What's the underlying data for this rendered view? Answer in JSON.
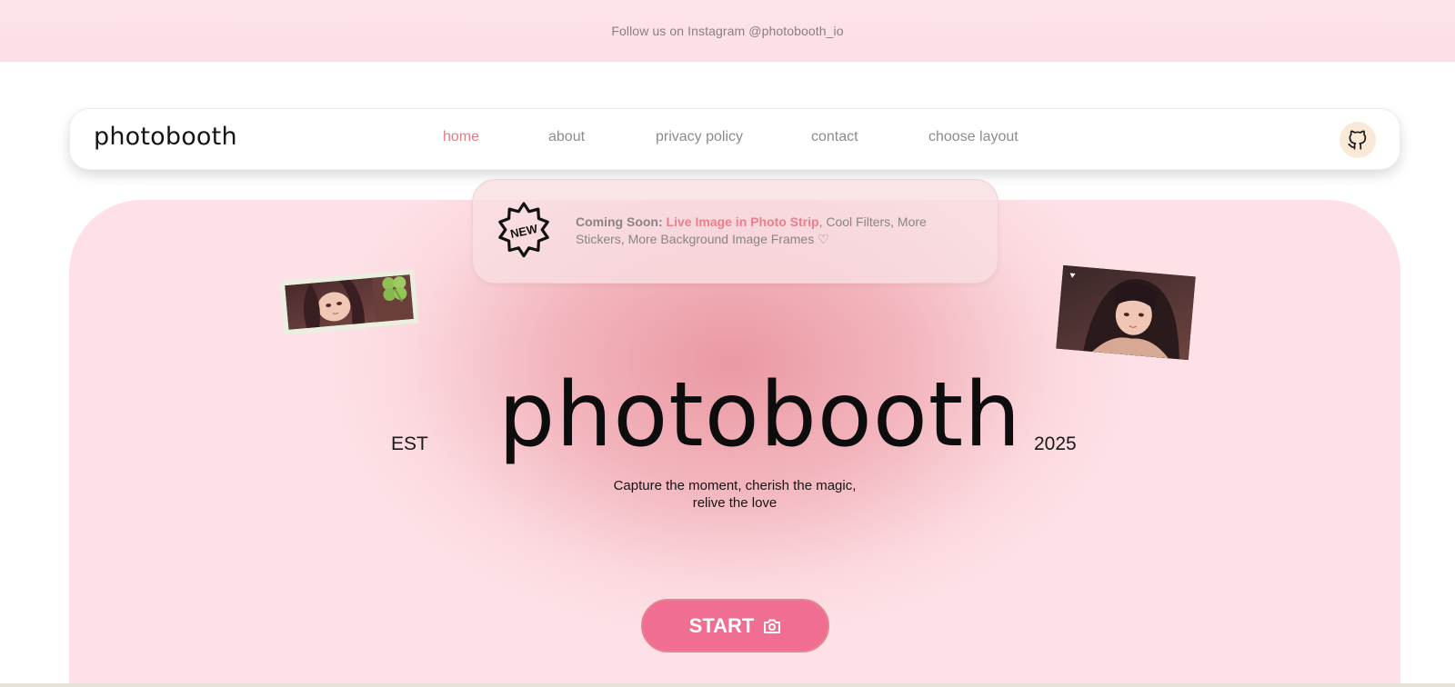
{
  "topbar": {
    "text": "Follow us on Instagram @photobooth_io"
  },
  "navbar": {
    "brand": "photobooth",
    "links": [
      {
        "label": "home",
        "active": true
      },
      {
        "label": "about",
        "active": false
      },
      {
        "label": "privacy policy",
        "active": false
      },
      {
        "label": "contact",
        "active": false
      },
      {
        "label": "choose layout",
        "active": false
      }
    ],
    "github_icon": "github-icon"
  },
  "announcement": {
    "badge": "NEW",
    "lead": "Coming Soon:",
    "highlight": "Live Image in Photo Strip",
    "rest": ", Cool Filters, More Stickers, More Background Image Frames ♡"
  },
  "hero": {
    "est": "EST",
    "title": "photobooth",
    "year": "2025",
    "tagline_line1": "Capture the moment, cherish the magic,",
    "tagline_line2": "relive the love",
    "start_label": "START",
    "start_icon": "camera-icon"
  },
  "colors": {
    "accent": "#ef6e92",
    "active_link": "#e07a87",
    "highlight": "#e9808e",
    "topbar_bg": "#fde3e8"
  }
}
